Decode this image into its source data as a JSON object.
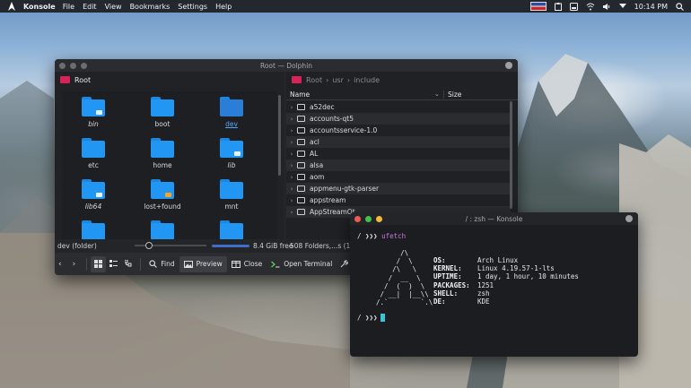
{
  "topbar": {
    "app_name": "Konsole",
    "menus": [
      "File",
      "Edit",
      "View",
      "Bookmarks",
      "Settings",
      "Help"
    ],
    "clock": "10:14 PM"
  },
  "dolphin": {
    "title": "Root — Dolphin",
    "left_pane": {
      "location": "Root",
      "items": [
        {
          "label": "bin",
          "italic": true,
          "emblem": "link"
        },
        {
          "label": "boot",
          "italic": false
        },
        {
          "label": "dev",
          "italic": false,
          "selected": true
        },
        {
          "label": "etc",
          "italic": false
        },
        {
          "label": "home",
          "italic": false
        },
        {
          "label": "lib",
          "italic": true,
          "emblem": "link"
        },
        {
          "label": "lib64",
          "italic": true,
          "emblem": "link"
        },
        {
          "label": "lost+found",
          "italic": false,
          "emblem": "lock"
        },
        {
          "label": "mnt",
          "italic": false
        },
        {
          "label": "",
          "italic": false
        },
        {
          "label": "",
          "italic": false
        },
        {
          "label": "",
          "italic": false
        }
      ]
    },
    "right_pane": {
      "breadcrumb": [
        "Root",
        "usr",
        "include"
      ],
      "columns": {
        "name": "Name",
        "size": "Size"
      },
      "rows": [
        "a52dec",
        "accounts-qt5",
        "accountsservice-1.0",
        "acl",
        "AL",
        "alsa",
        "aom",
        "appmenu-gtk-parser",
        "appstream",
        "AppStreamQt"
      ]
    },
    "status": {
      "text": "dev (folder)",
      "zoom_fraction": 0.17,
      "free_space": "8.4 GiB free",
      "count": "508 Folders,...s (14.9 KiB)"
    },
    "toolbar": {
      "find": "Find",
      "preview": "Preview",
      "close": "Close",
      "open_terminal": "Open Terminal"
    }
  },
  "konsole": {
    "title": "/ : zsh — Konsole",
    "prompt_dir": "/",
    "prompt_symbol": "❯❯❯",
    "command": "ufetch",
    "art": "        /\\\n       /  \\\n      /\\   \\\n     /  __  \\\n    /  (  )  \\\n   / __|  |__\\\\\n  /.`        `.\\",
    "info": [
      {
        "key": "OS:",
        "value": "Arch Linux"
      },
      {
        "key": "KERNEL:",
        "value": "Linux 4.19.57-1-lts"
      },
      {
        "key": "UPTIME:",
        "value": "1 day, 1 hour, 10 minutes"
      },
      {
        "key": "PACKAGES:",
        "value": "1251"
      },
      {
        "key": "SHELL:",
        "value": "zsh"
      },
      {
        "key": "DE:",
        "value": "KDE"
      }
    ]
  }
}
